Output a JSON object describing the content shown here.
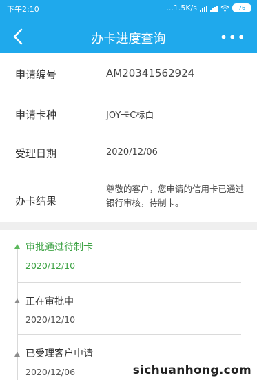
{
  "status_bar": {
    "time": "下午2:10",
    "net_speed": "...1.5K/s",
    "battery": "76"
  },
  "header": {
    "title": "办卡进度查询",
    "more": "•••",
    "back_icon": "chevron-left-icon",
    "color": "#1fa9ec"
  },
  "info": {
    "rows": [
      {
        "label": "申请编号",
        "value": "AM20341562924"
      },
      {
        "label": "申请卡种",
        "value": "JOY卡C标白"
      },
      {
        "label": "受理日期",
        "value": "2020/12/06"
      },
      {
        "label": "办卡结果",
        "value": "尊敬的客户，您申请的信用卡已通过银行审核，待制卡。"
      }
    ]
  },
  "timeline": {
    "steps": [
      {
        "title": "审批通过待制卡",
        "date": "2020/12/10",
        "active": true
      },
      {
        "title": "正在审批中",
        "date": "2020/12/10",
        "active": false
      },
      {
        "title": "已受理客户申请",
        "date": "2020/12/06",
        "active": false
      }
    ],
    "active_color": "#3ea345"
  },
  "watermark": "sichuanhong.com"
}
